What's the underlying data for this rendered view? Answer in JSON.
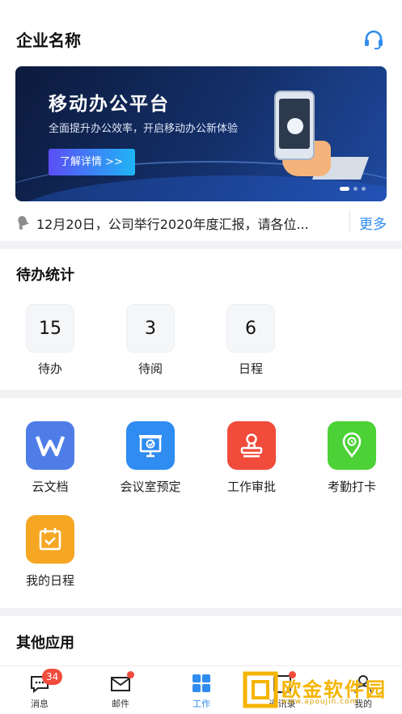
{
  "header": {
    "title": "企业名称",
    "support_icon": "headset-icon"
  },
  "banner": {
    "title": "移动办公平台",
    "subtitle": "全面提升办公效率，开启移动办公新体验",
    "button_label": "了解详情 >>",
    "slide_count": 3,
    "active_slide": 1
  },
  "notice": {
    "text": "12月20日，公司举行2020年度汇报，请各位...",
    "more_label": "更多"
  },
  "todo": {
    "title": "待办统计",
    "items": [
      {
        "value": "15",
        "label": "待办"
      },
      {
        "value": "3",
        "label": "待阅"
      },
      {
        "value": "6",
        "label": "日程"
      }
    ]
  },
  "apps": {
    "items": [
      {
        "label": "云文档",
        "icon": "wps-icon",
        "color": "#4f7de8"
      },
      {
        "label": "会议室预定",
        "icon": "projector-icon",
        "color": "#2f8cf0"
      },
      {
        "label": "工作审批",
        "icon": "stamp-icon",
        "color": "#f04b3b"
      },
      {
        "label": "考勤打卡",
        "icon": "location-pin-icon",
        "color": "#4cd137"
      },
      {
        "label": "我的日程",
        "icon": "calendar-icon",
        "color": "#f5a623"
      }
    ]
  },
  "other_apps": {
    "title": "其他应用"
  },
  "tabbar": {
    "items": [
      {
        "label": "消息",
        "icon": "chat-icon",
        "badge": "34"
      },
      {
        "label": "邮件",
        "icon": "mail-icon"
      },
      {
        "label": "工作",
        "icon": "grid-icon",
        "active": true
      },
      {
        "label": "通讯录",
        "icon": "contacts-icon"
      },
      {
        "label": "我的",
        "icon": "person-icon"
      }
    ]
  },
  "watermark": {
    "text": "欧金软件园",
    "url": "www.apoujin.com"
  },
  "colors": {
    "accent": "#2f8cf0",
    "badge": "#f04b3b",
    "divider": "#f2f2f4"
  }
}
